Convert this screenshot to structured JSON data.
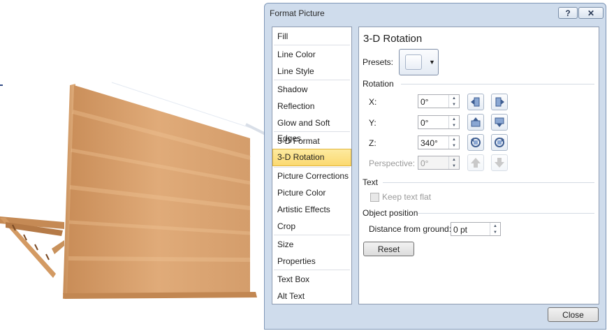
{
  "dialog": {
    "title": "Format Picture",
    "help_label": "?",
    "close_x_label": "✕",
    "close_button": "Close"
  },
  "categories": [
    {
      "label": "Fill",
      "selected": false
    },
    {
      "label": "Line Color",
      "selected": false
    },
    {
      "label": "Line Style",
      "selected": false
    },
    {
      "label": "Shadow",
      "selected": false
    },
    {
      "label": "Reflection",
      "selected": false
    },
    {
      "label": "Glow and Soft Edges",
      "selected": false
    },
    {
      "label": "3-D Format",
      "selected": false
    },
    {
      "label": "3-D Rotation",
      "selected": true
    },
    {
      "label": "Picture Corrections",
      "selected": false
    },
    {
      "label": "Picture Color",
      "selected": false
    },
    {
      "label": "Artistic Effects",
      "selected": false
    },
    {
      "label": "Crop",
      "selected": false
    },
    {
      "label": "Size",
      "selected": false
    },
    {
      "label": "Properties",
      "selected": false
    },
    {
      "label": "Text Box",
      "selected": false
    },
    {
      "label": "Alt Text",
      "selected": false
    }
  ],
  "panel": {
    "title": "3-D Rotation",
    "presets_label": "Presets:",
    "rotation_section": "Rotation",
    "x_label": "X:",
    "x_value": "0°",
    "y_label": "Y:",
    "y_value": "0°",
    "z_label": "Z:",
    "z_value": "340°",
    "perspective_label": "Perspective:",
    "perspective_value": "0°",
    "text_section": "Text",
    "keep_text_flat_label": "Keep text flat",
    "object_position_section": "Object position",
    "distance_label": "Distance from ground:",
    "distance_value": "0 pt",
    "reset_button": "Reset"
  },
  "icons": {
    "rotate_left": "rotate-left-icon",
    "rotate_right": "rotate-right-icon",
    "rotate_up": "rotate-up-icon",
    "rotate_down": "rotate-down-icon",
    "rotate_ccw": "rotate-counterclockwise-icon",
    "rotate_cw": "rotate-clockwise-icon",
    "perspective_increase": "perspective-increase-icon",
    "perspective_decrease": "perspective-decrease-icon"
  },
  "colors": {
    "dialog_bg": "#cfdcec",
    "selection": "#fbd970",
    "wood": "#d9a06a"
  }
}
